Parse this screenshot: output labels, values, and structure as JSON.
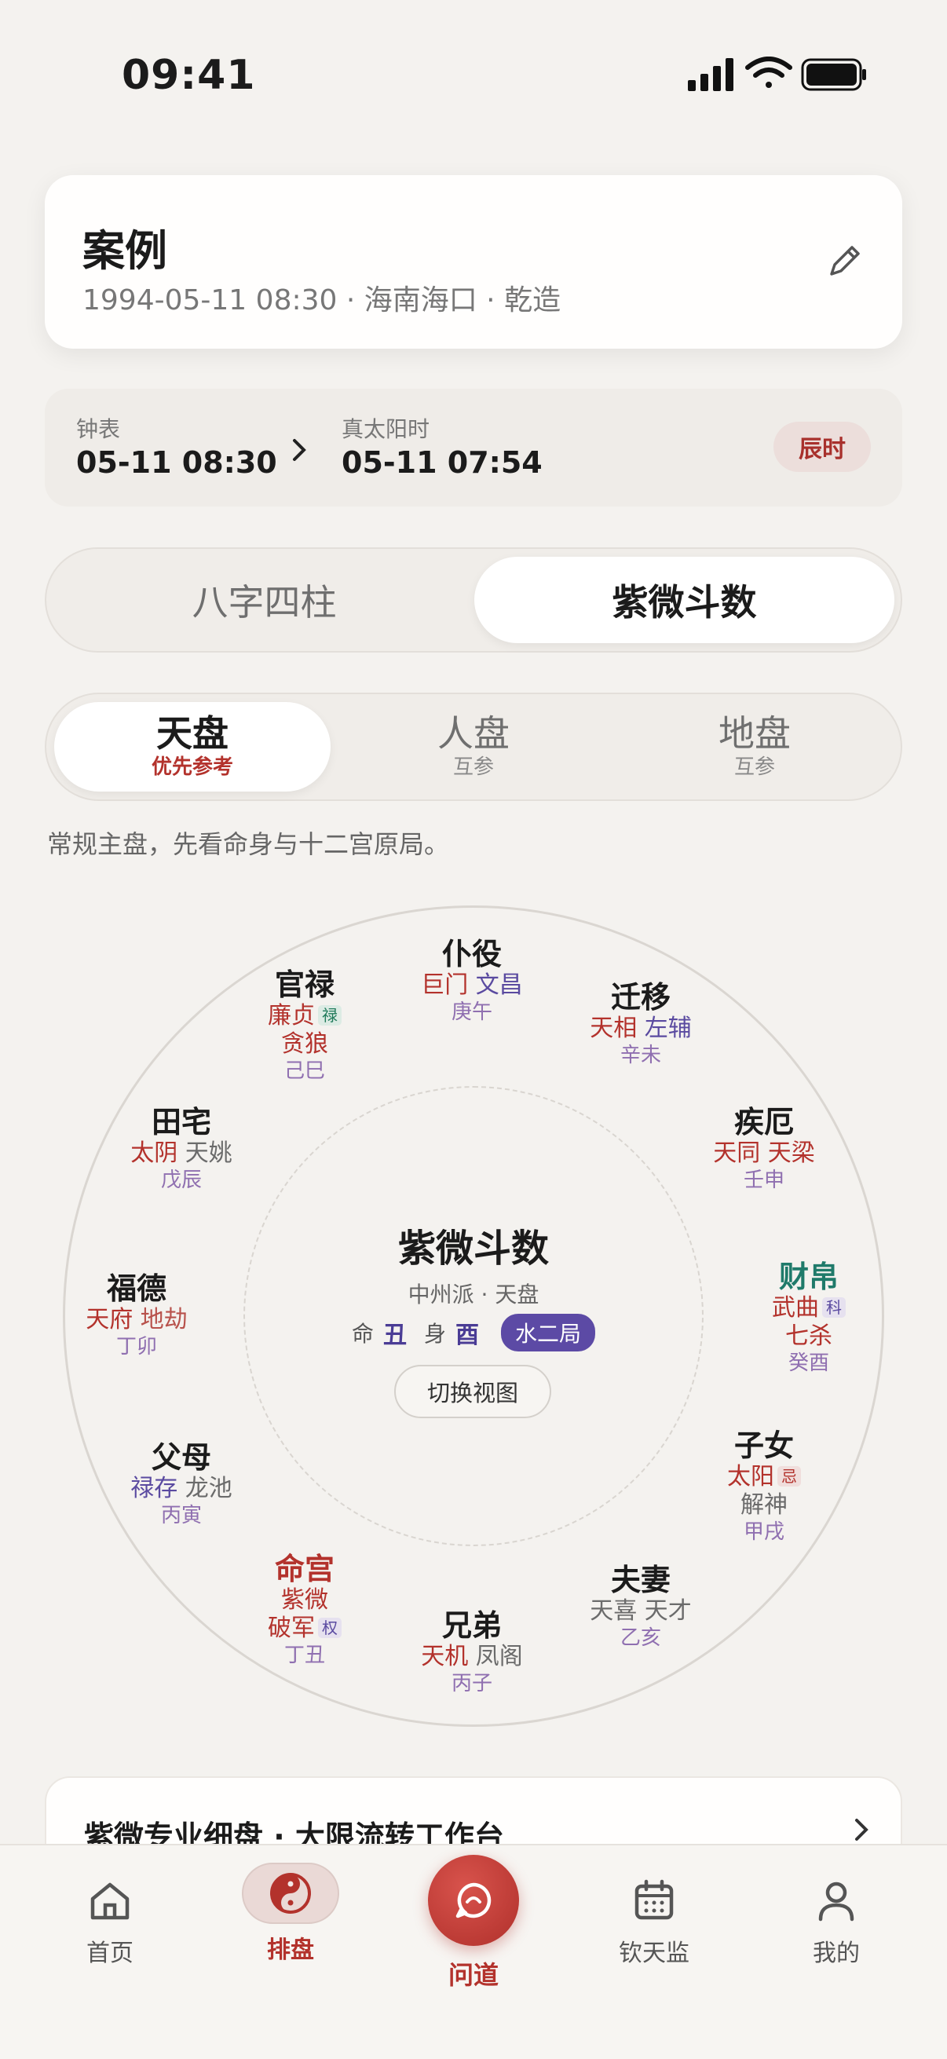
{
  "status": {
    "time": "09:41"
  },
  "case": {
    "title": "案例",
    "subtitle": "1994-05-11 08:30 · 海南海口 · 乾造"
  },
  "time_row": {
    "clock_label": "钟表",
    "clock_value": "05-11 08:30",
    "solar_label": "真太阳时",
    "solar_value": "05-11 07:54",
    "shi_badge": "辰时"
  },
  "main_tabs": [
    {
      "label": "八字四柱",
      "active": false
    },
    {
      "label": "紫微斗数",
      "active": true
    }
  ],
  "sub_tabs": [
    {
      "label": "天盘",
      "sub": "优先参考",
      "active": true
    },
    {
      "label": "人盘",
      "sub": "互参",
      "active": false
    },
    {
      "label": "地盘",
      "sub": "互参",
      "active": false
    }
  ],
  "hint": "常规主盘，先看命身与十二宫原局。",
  "chart": {
    "center": {
      "title": "紫微斗数",
      "subtitle": "中州派 · 天盘",
      "ming_label": "命",
      "ming_value": "丑",
      "shen_label": "身",
      "shen_value": "酉",
      "ju": "水二局",
      "switch_label": "切换视图"
    },
    "palaces": [
      {
        "name": "仆役",
        "l1": "巨门",
        "l2": "文昌",
        "gz": "庚午"
      },
      {
        "name": "官禄",
        "l1": "廉贞",
        "l1tag": "禄",
        "l2": "贪狼",
        "gz": "己巳"
      },
      {
        "name": "迁移",
        "l1": "天相",
        "l2": "左辅",
        "gz": "辛未"
      },
      {
        "name": "田宅",
        "l1": "太阴",
        "l2": "天姚",
        "gz": "戊辰"
      },
      {
        "name": "疾厄",
        "l1": "天同",
        "l2": "天梁",
        "gz": "壬申"
      },
      {
        "name": "福德",
        "l1": "天府",
        "l2": "地劫",
        "gz": "丁卯"
      },
      {
        "name": "财帛",
        "l1": "武曲",
        "l1tag": "科",
        "l2": "七杀",
        "gz": "癸酉"
      },
      {
        "name": "父母",
        "l1": "禄存",
        "l2": "龙池",
        "gz": "丙寅"
      },
      {
        "name": "子女",
        "l1": "太阳",
        "l1tag": "忌",
        "l2": "解神",
        "gz": "甲戌"
      },
      {
        "name": "命宫",
        "l1": "紫微",
        "l2": "破军",
        "l2tag": "权",
        "gz": "丁丑"
      },
      {
        "name": "兄弟",
        "l1": "天机",
        "l2": "凤阁",
        "gz": "丙子"
      },
      {
        "name": "夫妻",
        "l1": "天喜",
        "l2": "天才",
        "gz": "乙亥"
      }
    ]
  },
  "promo": {
    "text": "紫微专业细盘 · 大限流转工作台"
  },
  "tabbar": [
    {
      "label": "首页",
      "icon": "home-icon"
    },
    {
      "label": "排盘",
      "icon": "yinyang-icon",
      "active": true
    },
    {
      "label": "问道",
      "icon": "chat-icon"
    },
    {
      "label": "钦天监",
      "icon": "calendar-icon"
    },
    {
      "label": "我的",
      "icon": "person-icon"
    }
  ],
  "colors": {
    "accent": "#b3322c",
    "purple": "#5c4aa5",
    "green": "#1f7a6a"
  }
}
